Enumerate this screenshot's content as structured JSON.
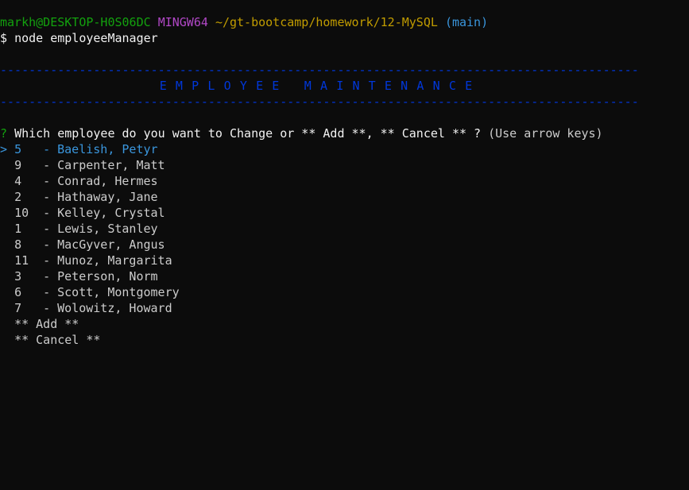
{
  "prompt_line": {
    "user_host": "markh@DESKTOP-H0S06DC",
    "system": "MINGW64",
    "path": "~/gt-bootcamp/homework/12-MySQL",
    "branch": "(main)"
  },
  "command_line": {
    "symbol": "$",
    "command": "node employeeManager"
  },
  "banner": {
    "rule": "--------------------------------------------------------------------------------------------",
    "title": "EMPLOYEE MAINTENANCE"
  },
  "question": {
    "marker": "?",
    "text": "Which employee do you want to Change or ** Add **, ** Cancel ** ?",
    "hint": "(Use arrow keys)"
  },
  "pointer": ">",
  "choices": [
    {
      "id": "5",
      "name": "Baelish, Petyr"
    },
    {
      "id": "9",
      "name": "Carpenter, Matt"
    },
    {
      "id": "4",
      "name": "Conrad, Hermes"
    },
    {
      "id": "2",
      "name": "Hathaway, Jane"
    },
    {
      "id": "10",
      "name": "Kelley, Crystal"
    },
    {
      "id": "1",
      "name": "Lewis, Stanley"
    },
    {
      "id": "8",
      "name": "MacGyver, Angus"
    },
    {
      "id": "11",
      "name": "Munoz, Margarita"
    },
    {
      "id": "3",
      "name": "Peterson, Norm"
    },
    {
      "id": "6",
      "name": "Scott, Montgomery"
    },
    {
      "id": "7",
      "name": "Wolowitz, Howard"
    }
  ],
  "extra_choices": {
    "add": "** Add **",
    "cancel": "** Cancel **"
  },
  "selected_index": 0,
  "colors": {
    "background": "#0c0c0c",
    "text": "#cccccc",
    "green": "#13a10e",
    "purple": "#b148c6",
    "yellow": "#c19c00",
    "cyan": "#3a96dd",
    "blue": "#0037da"
  }
}
